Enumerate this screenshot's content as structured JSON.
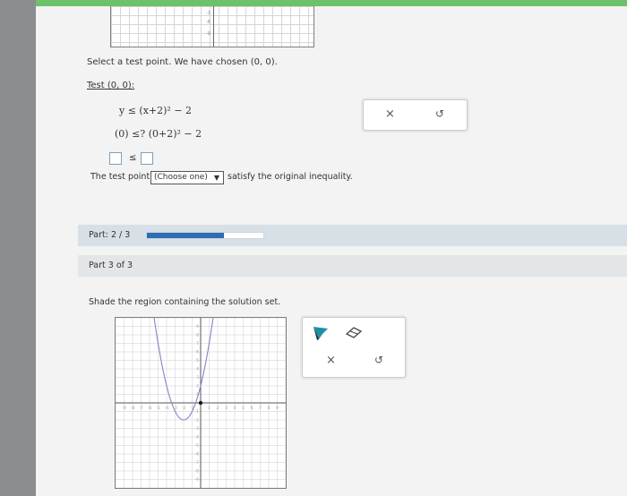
{
  "part2": {
    "instruction": "Select a test point. We have chosen (0, 0).",
    "test_label": "Test (0, 0):",
    "inequality": "y ≤ (x+2)² − 2",
    "substitution": "(0) ≤? (0+2)² − 2",
    "compare_symbol": "≤",
    "sentence_prefix": "The test point",
    "dropdown_value": "(Choose one)",
    "dropdown_arrow": "▼",
    "sentence_suffix": "satisfy the original inequality.",
    "clear_icon": "×",
    "undo_icon": "↺"
  },
  "progress": {
    "label": "Part: 2 / 3",
    "fraction": 0.66
  },
  "part3": {
    "label": "Part 3 of 3",
    "instruction": "Shade the region containing the solution set.",
    "clear_icon": "×",
    "undo_icon": "↺",
    "tools": [
      "shade-pointer-icon",
      "eraser-icon"
    ]
  },
  "graph": {
    "x_range": [
      -10,
      10
    ],
    "y_range": [
      -10,
      10
    ],
    "curve": "y = (x+2)^2 - 2",
    "vertex": [
      -2,
      -2
    ],
    "curve_color": "#8a82c8",
    "point_color": "#1a1a1a",
    "point": [
      0,
      0
    ]
  }
}
